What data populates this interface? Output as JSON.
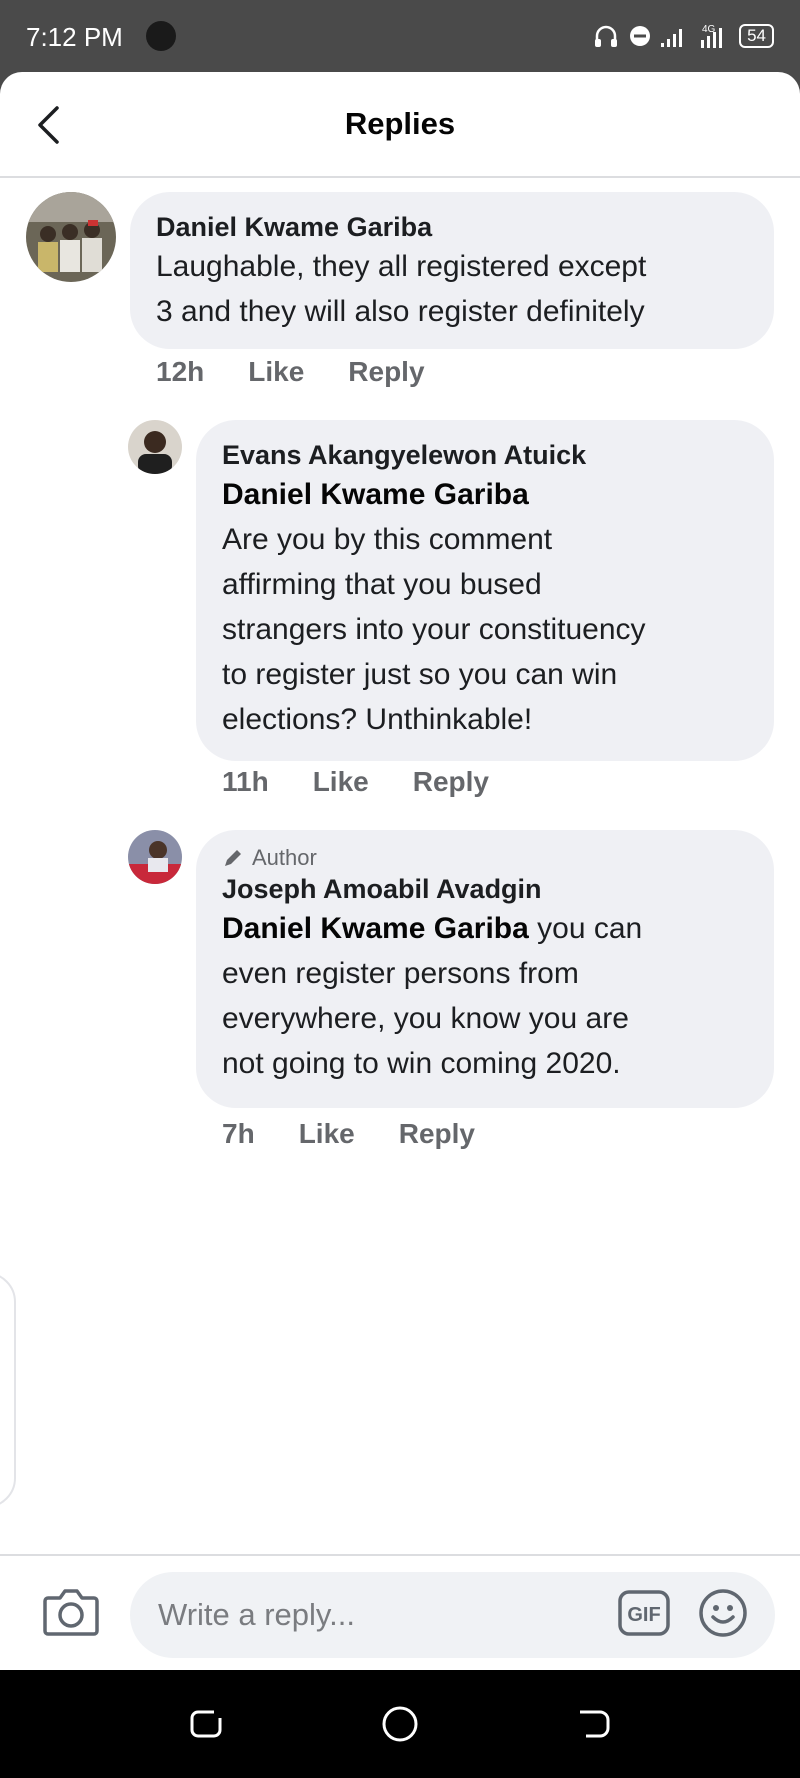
{
  "status_bar": {
    "time": "7:12 PM",
    "network": "4G",
    "battery": "54"
  },
  "header": {
    "title": "Replies",
    "back_icon": "chevron-left-icon"
  },
  "comments": [
    {
      "author": "Daniel Kwame Gariba",
      "text_lines": [
        "Laughable, they all registered except",
        "3 and they will also register definitely"
      ],
      "time": "12h",
      "like_label": "Like",
      "reply_label": "Reply"
    },
    {
      "author": "Evans Akangyelewon Atuick",
      "mention": "Daniel Kwame Gariba",
      "text_lines": [
        "Are you by this comment",
        "affirming that you bused",
        "strangers into your constituency",
        "to register just so you can win",
        "elections? Unthinkable!"
      ],
      "time": "11h",
      "like_label": "Like",
      "reply_label": "Reply"
    },
    {
      "badge": "Author",
      "author": "Joseph Amoabil Avadgin",
      "mention": "Daniel Kwame Gariba",
      "text_first": " you can",
      "text_lines": [
        "even register persons from",
        "everywhere, you know you are",
        "not going to win coming 2020."
      ],
      "time": "7h",
      "like_label": "Like",
      "reply_label": "Reply"
    }
  ],
  "composer": {
    "placeholder": "Write a reply...",
    "camera_icon": "camera-icon",
    "gif_label": "GIF",
    "emoji_icon": "smiley-icon"
  },
  "colors": {
    "bubble": "#eff0f4",
    "secondary_text": "#65676b",
    "status_bar": "#4a4a4a"
  }
}
